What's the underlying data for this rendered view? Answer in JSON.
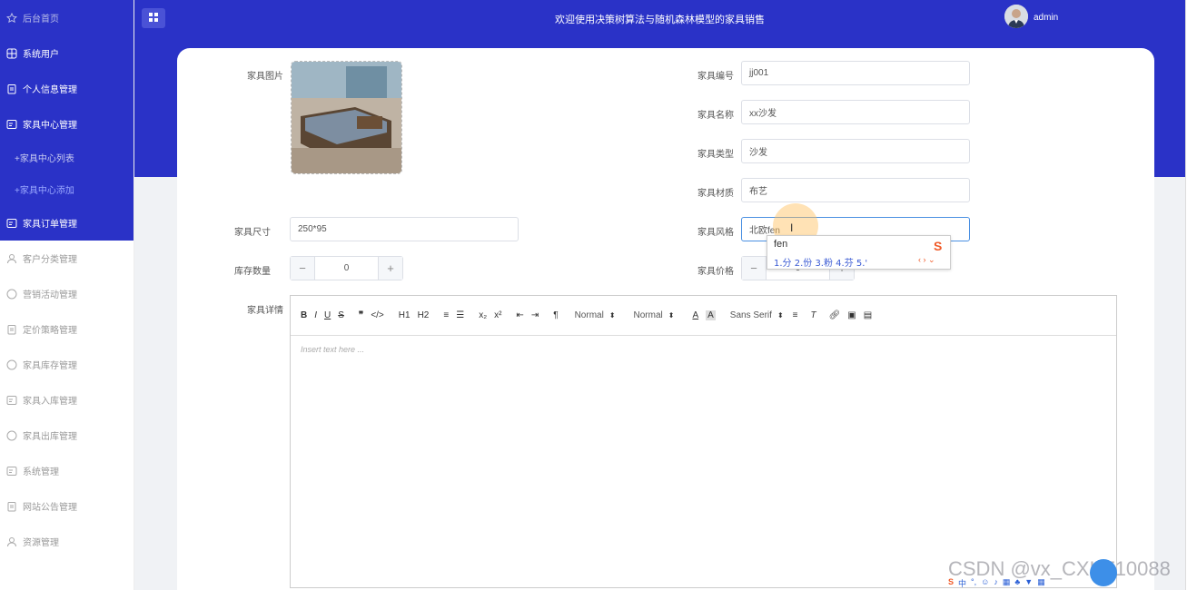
{
  "header": {
    "title": "欢迎使用决策树算法与随机森林模型的家具销售",
    "username": "admin"
  },
  "sidebar": {
    "items": [
      {
        "label": "后台首页",
        "icon": "star-icon"
      },
      {
        "label": "系统用户",
        "icon": "grid-icon"
      },
      {
        "label": "个人信息管理",
        "icon": "clipboard-icon"
      },
      {
        "label": "家具中心管理",
        "icon": "doc-icon"
      }
    ],
    "subitems": [
      {
        "label": "+家具中心列表"
      },
      {
        "label": "+家具中心添加",
        "active": true
      }
    ],
    "items2": [
      {
        "label": "家具订单管理",
        "icon": "doc-icon"
      }
    ],
    "items3": [
      {
        "label": "客户分类管理",
        "icon": "user-icon"
      },
      {
        "label": "营销活动管理",
        "icon": "chat-icon"
      },
      {
        "label": "定价策略管理",
        "icon": "clipboard-icon"
      },
      {
        "label": "家具库存管理",
        "icon": "chat-icon"
      },
      {
        "label": "家具入库管理",
        "icon": "doc-icon"
      },
      {
        "label": "家具出库管理",
        "icon": "chat-icon"
      },
      {
        "label": "系统管理",
        "icon": "doc-icon"
      },
      {
        "label": "网站公告管理",
        "icon": "clipboard-icon"
      },
      {
        "label": "资源管理",
        "icon": "user-icon"
      }
    ]
  },
  "form": {
    "image_label": "家具图片",
    "code_label": "家具编号",
    "code_value": "jj001",
    "name_label": "家具名称",
    "name_value": "xx沙发",
    "type_label": "家具类型",
    "type_value": "沙发",
    "material_label": "家具材质",
    "material_value": "布艺",
    "size_label": "家具尺寸",
    "size_value": "250*95",
    "style_label": "家具风格",
    "style_value": "北欧fen",
    "stock_label": "库存数量",
    "stock_value": "0",
    "price_label": "家具价格",
    "price_value": "0",
    "detail_label": "家具详情"
  },
  "editor": {
    "toolbar": [
      "B",
      "I",
      "U",
      "S",
      "❞",
      "</>",
      "H1",
      "H2",
      "≡",
      "☰",
      "x₂",
      "x²",
      "⇤",
      "⇥",
      "¶"
    ],
    "header_select": "Normal",
    "size_select": "Normal",
    "font_select": "Sans Serif",
    "placeholder": "Insert text here ..."
  },
  "ime": {
    "composition": "fen",
    "candidates": "1.分  2.份  3.粉  4.芬  5.'"
  },
  "watermark": "CSDN @vx_CXKF10088",
  "colors": {
    "primary": "#2a32c7",
    "accent": "#4a90e2"
  }
}
